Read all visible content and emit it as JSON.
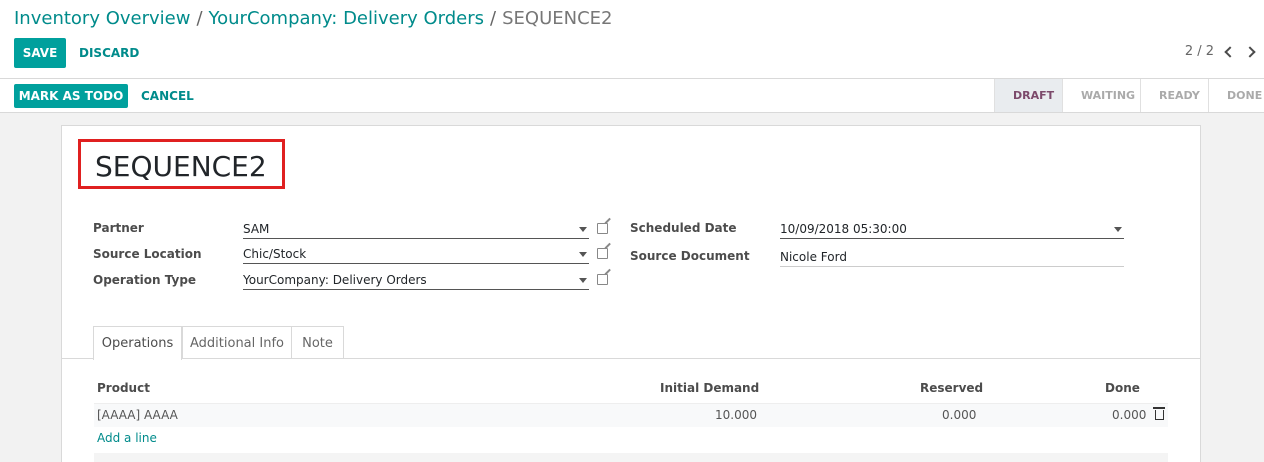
{
  "breadcrumb": {
    "items": [
      "Inventory Overview",
      "YourCompany: Delivery Orders"
    ],
    "separator": "/",
    "current": "SEQUENCE2"
  },
  "toolbar": {
    "save_label": "SAVE",
    "discard_label": "DISCARD"
  },
  "pager": {
    "text": "2 / 2"
  },
  "actions": {
    "mark_todo_label": "MARK AS TODO",
    "cancel_label": "CANCEL"
  },
  "stages": [
    "DRAFT",
    "WAITING",
    "READY",
    "DONE"
  ],
  "active_stage": "DRAFT",
  "record": {
    "title": "SEQUENCE2",
    "partner_label": "Partner",
    "partner_value": "SAM",
    "source_location_label": "Source Location",
    "source_location_value": "Chic/Stock",
    "operation_type_label": "Operation Type",
    "operation_type_value": "YourCompany: Delivery Orders",
    "scheduled_date_label": "Scheduled Date",
    "scheduled_date_value": "10/09/2018 05:30:00",
    "source_document_label": "Source Document",
    "source_document_value": "Nicole Ford"
  },
  "tabs": [
    "Operations",
    "Additional Info",
    "Note"
  ],
  "table": {
    "headers": {
      "product": "Product",
      "initial_demand": "Initial Demand",
      "reserved": "Reserved",
      "done": "Done"
    },
    "rows": [
      {
        "product": "[AAAA] AAAA",
        "initial_demand": "10.000",
        "reserved": "0.000",
        "done": "0.000"
      }
    ],
    "add_line": "Add a line"
  },
  "colors": {
    "accent": "#00a09d",
    "link": "#008b8b",
    "highlight_box": "#e02020"
  }
}
